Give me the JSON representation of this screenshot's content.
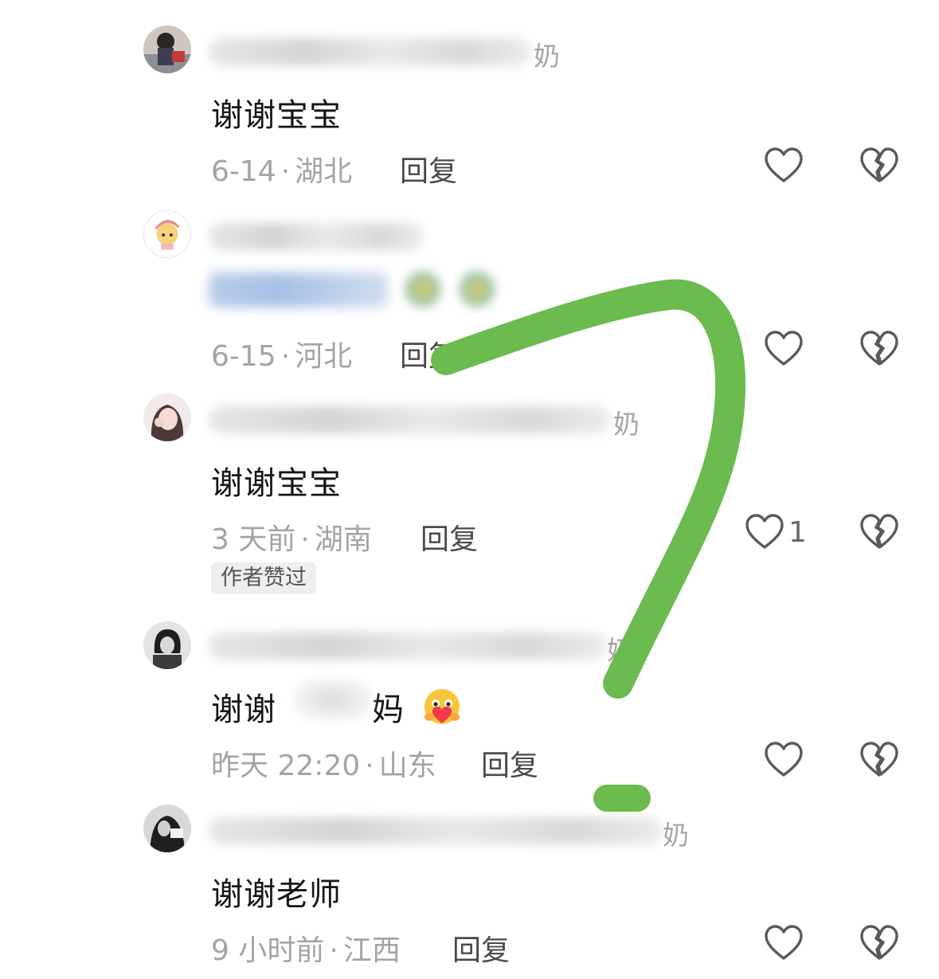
{
  "comments": [
    {
      "name_suffix": "奶",
      "text": "谢谢宝宝",
      "date": "6-14",
      "location": "湖北",
      "reply": "回复",
      "like_count": "",
      "badge": ""
    },
    {
      "name_suffix": "",
      "text": "",
      "date": "6-15",
      "location": "河北",
      "reply": "回复",
      "like_count": "",
      "badge": ""
    },
    {
      "name_suffix": "奶",
      "text": "谢谢宝宝",
      "date": "3 天前",
      "location": "湖南",
      "reply": "回复",
      "like_count": "1",
      "badge": "作者赞过"
    },
    {
      "name_suffix": "奶",
      "text_prefix": "谢谢",
      "text_suffix": "妈",
      "date": "昨天 22:20",
      "location": "山东",
      "reply": "回复",
      "like_count": "",
      "badge": ""
    },
    {
      "name_suffix": "奶",
      "text": "谢谢老师",
      "date": "9 小时前",
      "location": "江西",
      "reply": "回复",
      "like_count": "",
      "badge": ""
    }
  ],
  "separator": "·",
  "icons": {
    "like": "heart-outline-icon",
    "dislike": "broken-heart-icon",
    "emoji": "hugging-heart-emoji"
  },
  "colors": {
    "annotation": "#6cbb4f",
    "meta_text": "#a4a4a4",
    "reply_text": "#4a4a4a",
    "body_text": "#161616",
    "icon_stroke": "#5a5a5a"
  }
}
